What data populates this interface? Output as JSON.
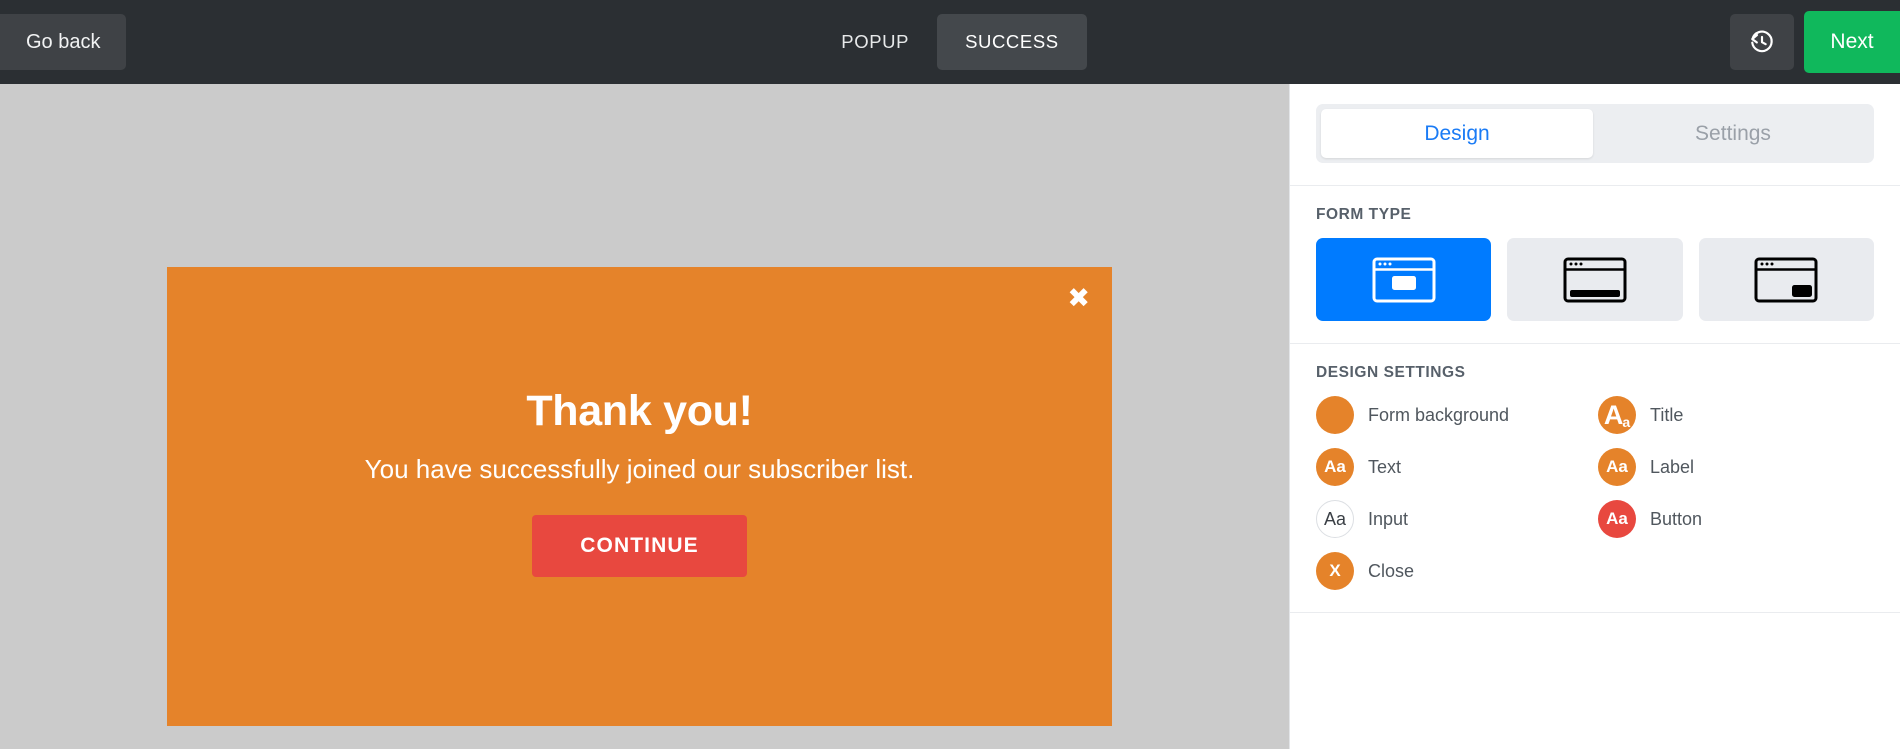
{
  "topbar": {
    "go_back_label": "Go back",
    "steps": [
      {
        "label": "POPUP",
        "active": false
      },
      {
        "label": "SUCCESS",
        "active": true
      }
    ],
    "history_icon": "history-clock-icon",
    "next_label": "Next",
    "next_color": "#10b85c",
    "background_color": "#2b2f33"
  },
  "canvas": {
    "background_color": "#cbcbcb",
    "popup": {
      "background_color": "#e5832a",
      "close_icon": "close-x-icon",
      "title": "Thank you!",
      "text": "You have successfully joined our subscriber list.",
      "button_label": "CONTINUE",
      "button_color": "#e8483f"
    }
  },
  "panel": {
    "tabs": [
      {
        "label": "Design",
        "active": true
      },
      {
        "label": "Settings",
        "active": false
      }
    ],
    "active_tab_color": "#1a7bf5",
    "form_type": {
      "heading": "FORM TYPE",
      "options": [
        {
          "name": "popup-centered",
          "selected": true
        },
        {
          "name": "bottom-bar",
          "selected": false
        },
        {
          "name": "corner-box",
          "selected": false
        }
      ],
      "selected_color": "#007bff"
    },
    "design_settings": {
      "heading": "DESIGN SETTINGS",
      "items": [
        {
          "label": "Form background",
          "icon": "color-swatch-icon",
          "glyph": "",
          "color": "#e5832a",
          "style": "plain"
        },
        {
          "label": "Title",
          "icon": "title-type-icon",
          "glyph": "Aa",
          "color": "#e5832a",
          "style": "title"
        },
        {
          "label": "Text",
          "icon": "text-type-icon",
          "glyph": "Aa",
          "color": "#e5832a",
          "style": "plain"
        },
        {
          "label": "Label",
          "icon": "label-type-icon",
          "glyph": "Aa",
          "color": "#e5832a",
          "style": "plain"
        },
        {
          "label": "Input",
          "icon": "input-type-icon",
          "glyph": "Aa",
          "color": "#ffffff",
          "style": "outline"
        },
        {
          "label": "Button",
          "icon": "button-type-icon",
          "glyph": "Aa",
          "color": "#e8483f",
          "style": "plain"
        },
        {
          "label": "Close",
          "icon": "close-type-icon",
          "glyph": "X",
          "color": "#e5832a",
          "style": "plain"
        }
      ]
    }
  }
}
